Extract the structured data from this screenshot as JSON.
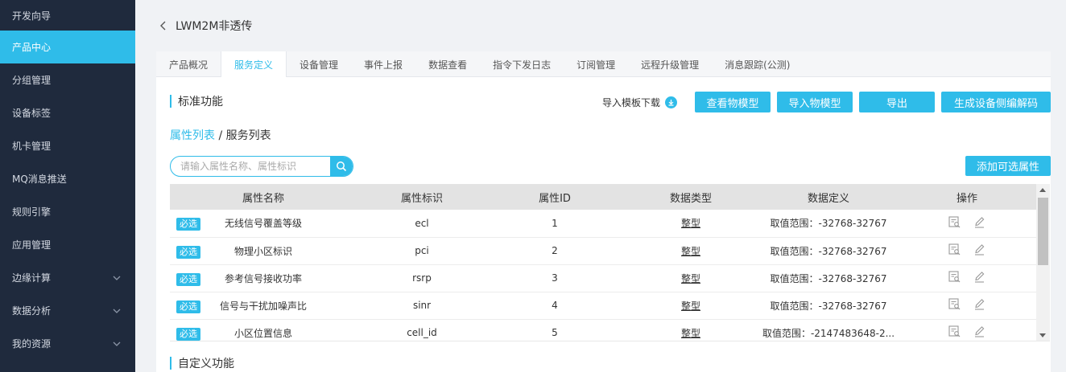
{
  "sidebar": {
    "items": [
      {
        "label": "开发向导",
        "active": false,
        "expandable": false
      },
      {
        "label": "产品中心",
        "active": true,
        "expandable": false
      },
      {
        "label": "分组管理",
        "active": false,
        "expandable": false
      },
      {
        "label": "设备标签",
        "active": false,
        "expandable": false
      },
      {
        "label": "机卡管理",
        "active": false,
        "expandable": false
      },
      {
        "label": "MQ消息推送",
        "active": false,
        "expandable": false
      },
      {
        "label": "规则引擎",
        "active": false,
        "expandable": false
      },
      {
        "label": "应用管理",
        "active": false,
        "expandable": false
      },
      {
        "label": "边缘计算",
        "active": false,
        "expandable": true
      },
      {
        "label": "数据分析",
        "active": false,
        "expandable": true
      },
      {
        "label": "我的资源",
        "active": false,
        "expandable": true
      }
    ]
  },
  "header": {
    "title": "LWM2M非透传"
  },
  "tabs": [
    {
      "label": "产品概况",
      "active": false
    },
    {
      "label": "服务定义",
      "active": true
    },
    {
      "label": "设备管理",
      "active": false
    },
    {
      "label": "事件上报",
      "active": false
    },
    {
      "label": "数据查看",
      "active": false
    },
    {
      "label": "指令下发日志",
      "active": false
    },
    {
      "label": "订阅管理",
      "active": false
    },
    {
      "label": "远程升级管理",
      "active": false
    },
    {
      "label": "消息跟踪(公测)",
      "active": false
    }
  ],
  "standard": {
    "title": "标准功能",
    "template_download": "导入模板下载",
    "buttons": {
      "view_model": "查看物模型",
      "import_model": "导入物模型",
      "export": "导出",
      "gen_codec": "生成设备侧编解码"
    }
  },
  "crumbs": {
    "property_list": "属性列表",
    "separator": "/",
    "service_list": "服务列表"
  },
  "search": {
    "placeholder": "请输入属性名称、属性标识",
    "value": ""
  },
  "add_optional": "添加可选属性",
  "table": {
    "headers": [
      "属性名称",
      "属性标识",
      "属性ID",
      "数据类型",
      "数据定义",
      "操作"
    ],
    "required_badge": "必选",
    "rows": [
      {
        "name": "无线信号覆盖等级",
        "ident": "ecl",
        "id": "1",
        "dtype": "整型",
        "def": "取值范围：-32768-32767"
      },
      {
        "name": "物理小区标识",
        "ident": "pci",
        "id": "2",
        "dtype": "整型",
        "def": "取值范围：-32768-32767"
      },
      {
        "name": "参考信号接收功率",
        "ident": "rsrp",
        "id": "3",
        "dtype": "整型",
        "def": "取值范围：-32768-32767"
      },
      {
        "name": "信号与干扰加噪声比",
        "ident": "sinr",
        "id": "4",
        "dtype": "整型",
        "def": "取值范围：-32768-32767"
      },
      {
        "name": "小区位置信息",
        "ident": "cell_id",
        "id": "5",
        "dtype": "整型",
        "def": "取值范围：-2147483648-2..."
      }
    ]
  },
  "custom": {
    "title": "自定义功能"
  },
  "colors": {
    "accent": "#2fbce9",
    "sidebar_bg": "#1f2a3d"
  }
}
